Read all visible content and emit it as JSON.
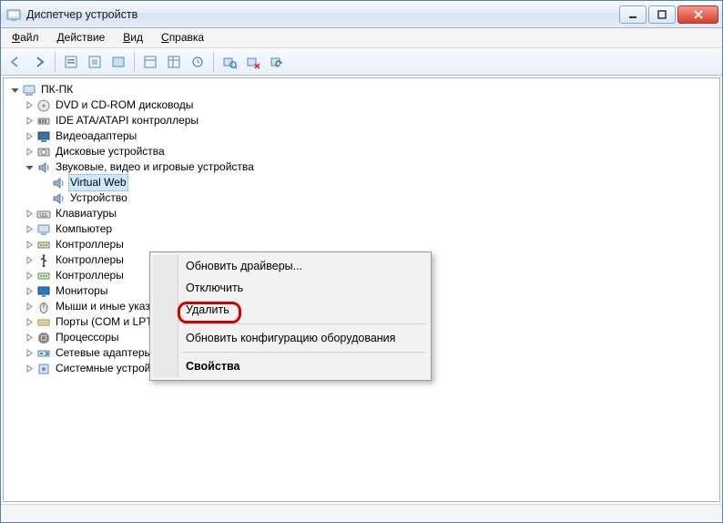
{
  "window": {
    "title": "Диспетчер устройств"
  },
  "menu": {
    "file": "Файл",
    "action": "Действие",
    "view": "Вид",
    "help": "Справка"
  },
  "toolbar": {
    "back": "Назад",
    "forward": "Вперёд",
    "show_hidden": "Показать скрытые",
    "prop1": "Свойства",
    "prop2": "Свойства",
    "help": "Справка",
    "scan": "Обновить",
    "uninstall": "Удалить",
    "update": "Обновить драйвер",
    "disable": "Отключить",
    "extra": "Действие"
  },
  "tree": {
    "root": "ПК-ПК",
    "items": [
      {
        "label": "DVD и CD-ROM дисководы",
        "icon": "disc"
      },
      {
        "label": "IDE ATA/ATAPI контроллеры",
        "icon": "ide"
      },
      {
        "label": "Видеоадаптеры",
        "icon": "display"
      },
      {
        "label": "Дисковые устройства",
        "icon": "disk"
      },
      {
        "label": "Звуковые, видео и игровые устройства",
        "icon": "sound",
        "expanded": true,
        "children": [
          {
            "label": "Virtual Web",
            "icon": "sound",
            "selected": true
          },
          {
            "label": "Устройство",
            "icon": "sound"
          }
        ]
      },
      {
        "label": "Клавиатуры",
        "icon": "keyboard"
      },
      {
        "label": "Компьютер",
        "icon": "computer"
      },
      {
        "label": "Контроллеры",
        "icon": "controller"
      },
      {
        "label": "Контроллеры",
        "icon": "usb"
      },
      {
        "label": "Контроллеры",
        "icon": "controller"
      },
      {
        "label": "Мониторы",
        "icon": "monitor"
      },
      {
        "label": "Мыши и иные указывающие устройства",
        "icon": "mouse"
      },
      {
        "label": "Порты (COM и LPT)",
        "icon": "port"
      },
      {
        "label": "Процессоры",
        "icon": "cpu"
      },
      {
        "label": "Сетевые адаптеры",
        "icon": "network"
      },
      {
        "label": "Системные устройства",
        "icon": "system"
      }
    ]
  },
  "context_menu": {
    "update_drivers": "Обновить драйверы...",
    "disable": "Отключить",
    "delete": "Удалить",
    "scan_hw": "Обновить конфигурацию оборудования",
    "properties": "Свойства"
  }
}
